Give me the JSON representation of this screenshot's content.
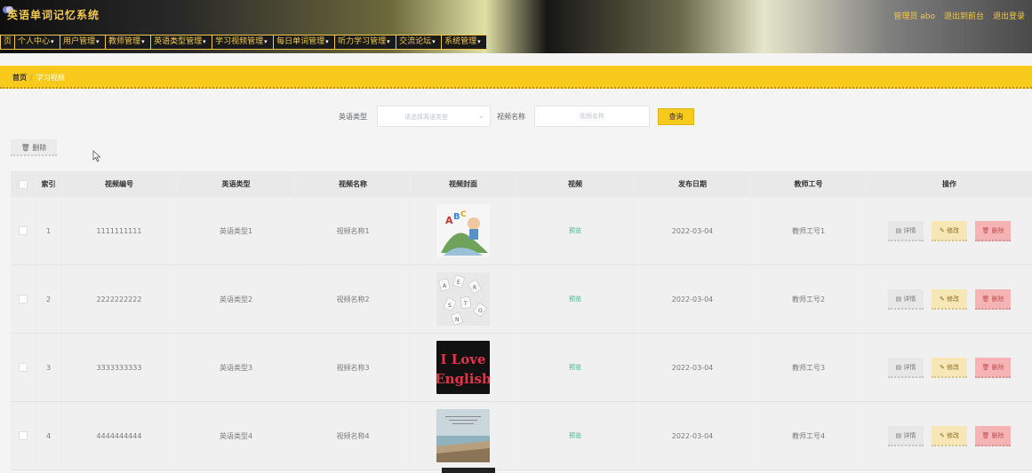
{
  "header": {
    "title": "英语单词记忆系统",
    "admin": "管理员 abo",
    "logout": "退出到前台",
    "exit": "退出登录"
  },
  "nav": [
    {
      "label": "页",
      "chevron": false
    },
    {
      "label": "个人中心",
      "chevron": true
    },
    {
      "label": "用户管理",
      "chevron": true
    },
    {
      "label": "教师管理",
      "chevron": true
    },
    {
      "label": "英语类型管理",
      "chevron": true
    },
    {
      "label": "学习视频管理",
      "chevron": true
    },
    {
      "label": "每日单词管理",
      "chevron": true
    },
    {
      "label": "听力学习管理",
      "chevron": true
    },
    {
      "label": "交流论坛",
      "chevron": true
    },
    {
      "label": "系统管理",
      "chevron": true
    }
  ],
  "breadcrumb": {
    "home": "首页",
    "separator": "/",
    "current": "学习视频"
  },
  "search": {
    "type_label": "英语类型",
    "type_placeholder": "请选择英语类型",
    "name_label": "视频名称",
    "name_placeholder": "视频名称",
    "query_button": "查询"
  },
  "toolbar": {
    "delete_label": "删除"
  },
  "table": {
    "headers": [
      "索引",
      "视频编号",
      "英语类型",
      "视频名称",
      "视频封面",
      "视频",
      "发布日期",
      "教师工号",
      "操作"
    ],
    "rows": [
      {
        "index": "1",
        "code": "1111111111",
        "type": "英语类型1",
        "name": "视频名称1",
        "cover": "abc-illustration",
        "video": "预览",
        "date": "2022-03-04",
        "teacher": "教师工号1"
      },
      {
        "index": "2",
        "code": "2222222222",
        "type": "英语类型2",
        "name": "视频名称2",
        "cover": "letter-tiles",
        "video": "预览",
        "date": "2022-03-04",
        "teacher": "教师工号2"
      },
      {
        "index": "3",
        "code": "3333333333",
        "type": "英语类型3",
        "name": "视频名称3",
        "cover": "i-love-english",
        "cover_text_1": "I Love",
        "cover_text_2": "English",
        "video": "预览",
        "date": "2022-03-04",
        "teacher": "教师工号3"
      },
      {
        "index": "4",
        "code": "4444444444",
        "type": "英语类型4",
        "name": "视频名称4",
        "cover": "beach-photo",
        "video": "预览",
        "date": "2022-03-04",
        "teacher": "教师工号4"
      }
    ],
    "actions": {
      "detail": "详情",
      "edit": "修改",
      "delete": "删除"
    }
  },
  "colors": {
    "accent": "#f7ca1b",
    "nav_bg": "#1a1a1a",
    "nav_text": "#f2c94c",
    "preview": "#3fb38a",
    "delete": "#f6b3b3",
    "edit": "#f7e6b6"
  }
}
